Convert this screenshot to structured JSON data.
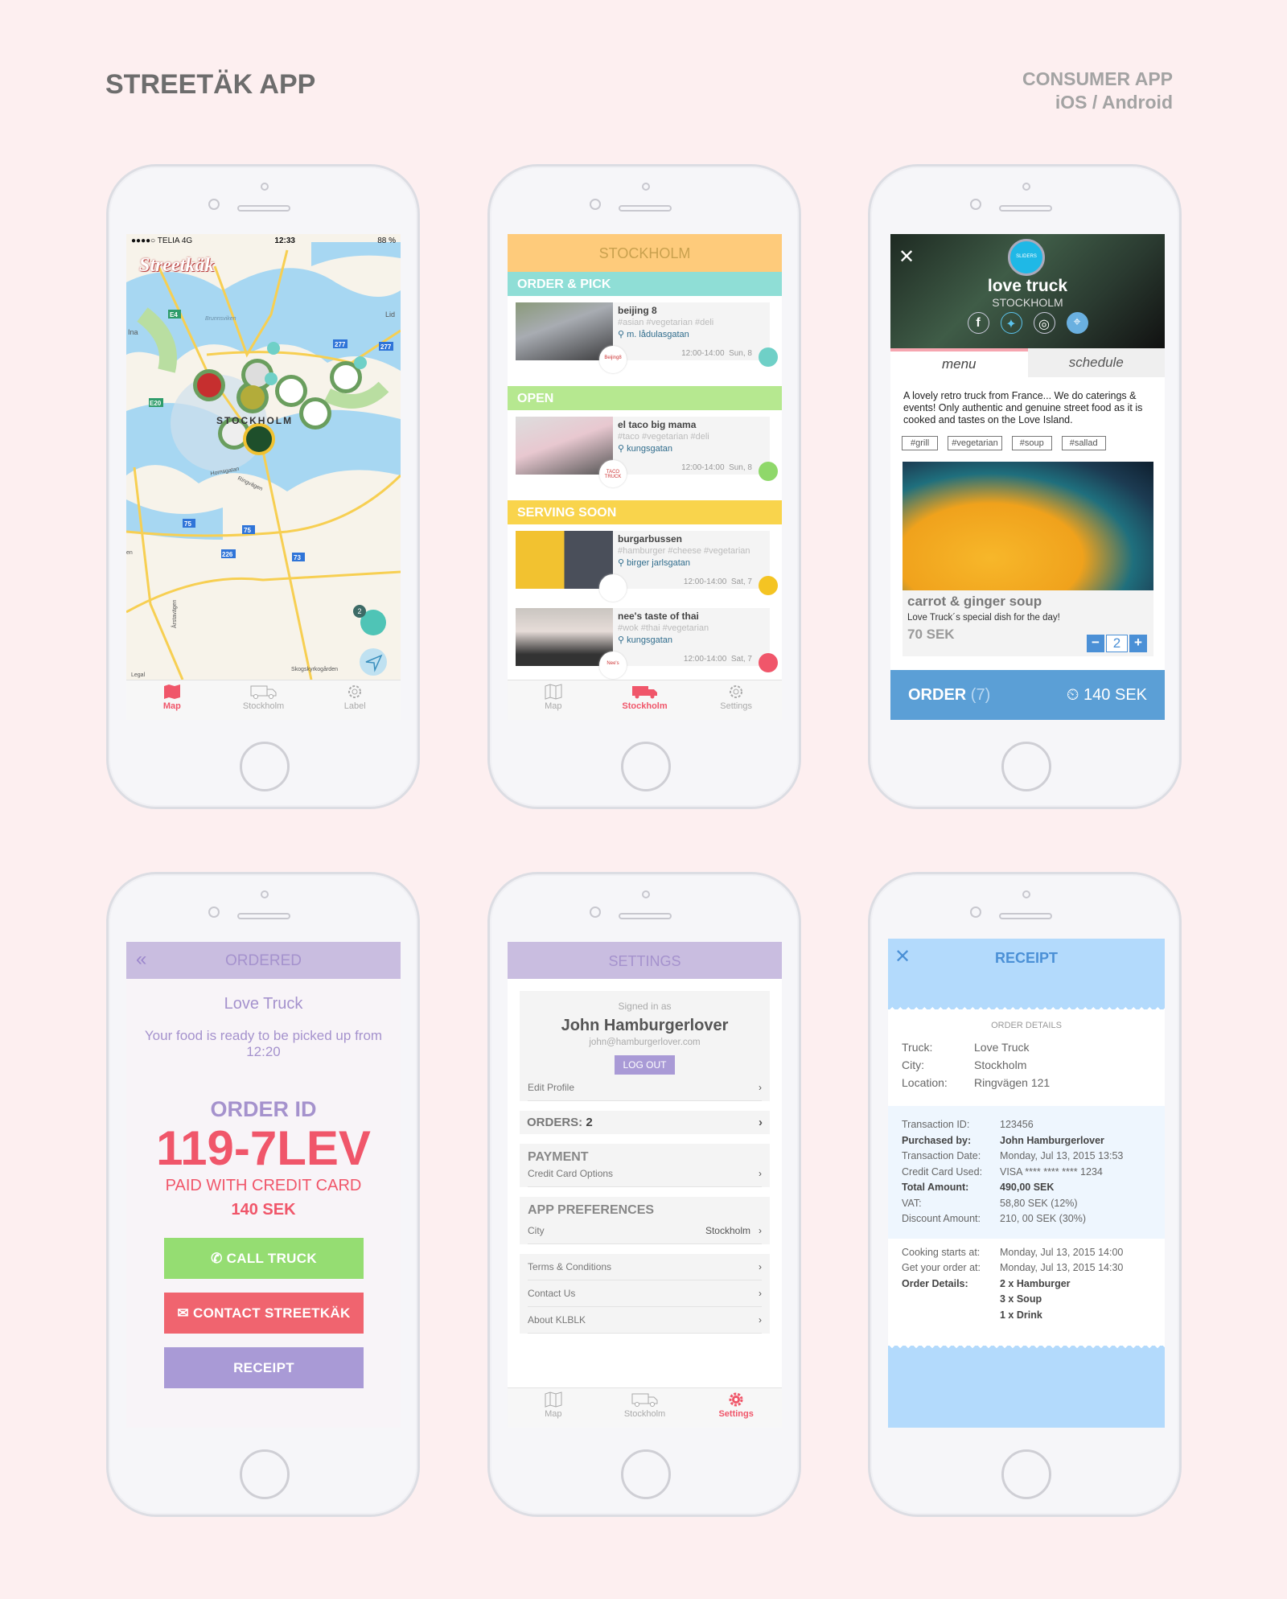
{
  "page": {
    "title": "STREETÄK APP",
    "subtitle_line1": "CONSUMER APP",
    "subtitle_line2": "iOS / Android"
  },
  "colors": {
    "background": "#fdeff0",
    "accent_red": "#f0566a",
    "teal": "#8fded6",
    "green": "#b6e890",
    "yellow": "#f9d44c",
    "orange": "#fecb7b",
    "lavender": "#c9bde0",
    "blue": "#5b9fd6",
    "receipt_blue": "#b3dafc"
  },
  "map_screen": {
    "status": {
      "carrier": "●●●●○ TELIA  4G",
      "time": "12:33",
      "battery": "88 %"
    },
    "logo": "Streetkäk",
    "labels": [
      "Lid",
      "Ina",
      "Brunnsviken",
      "STOCKHOLM",
      "Hornsgatan",
      "Ringvägen",
      "Skogskyrkogården",
      "Legal",
      "Årstavägen",
      "en"
    ],
    "road_badges": [
      "E4",
      "E20",
      "277",
      "277",
      "75",
      "75",
      "226",
      "73"
    ],
    "cart_count": "2",
    "tabs": [
      {
        "label": "Map",
        "icon": "map-icon",
        "active": true
      },
      {
        "label": "Stockholm",
        "icon": "truck-icon"
      },
      {
        "label": "Label",
        "icon": "gear-icon"
      }
    ]
  },
  "list_screen": {
    "header": "STOCKHOLM",
    "sections": [
      {
        "title": "ORDER & PICK",
        "color": "#8fded6",
        "items": [
          {
            "name": "beijing 8",
            "tags": "#asian #vegetarian #deli",
            "location": "m. lådulasgatan",
            "hours": "12:00-14:00",
            "day": "Sun, 8",
            "logo": "Beijing8",
            "status": "order-icon",
            "status_color": "#6fd0c7"
          }
        ]
      },
      {
        "title": "OPEN",
        "color": "#b6e890",
        "items": [
          {
            "name": "el taco big mama",
            "tags": "#taco #vegetarian #deli",
            "location": "kungsgatan",
            "hours": "12:00-14:00",
            "day": "Sun, 8",
            "logo": "TACO TRUCK",
            "status_color": "#8fd86a"
          }
        ]
      },
      {
        "title": "SERVING SOON",
        "color": "#f9d44c",
        "items": [
          {
            "name": "burgarbussen",
            "tags": "#hamburger #cheese #vegetarian",
            "location": "birger jarlsgatan",
            "hours": "12:00-14:00",
            "day": "Sat, 7",
            "logo": "",
            "status_color": "#f4c423"
          },
          {
            "name": "nee's taste of thai",
            "tags": "#wok #thai #vegetarian",
            "location": "kungsgatan",
            "hours": "12:00-14:00",
            "day": "Sat, 7",
            "logo": "Nee's",
            "status_color": "#f0566a"
          }
        ]
      }
    ],
    "tabs": [
      {
        "label": "Map"
      },
      {
        "label": "Stockholm",
        "active": true
      },
      {
        "label": "Settings"
      }
    ]
  },
  "truck_screen": {
    "name": "love truck",
    "city": "STOCKHOLM",
    "badge": "SLIDERS",
    "social": [
      "facebook-icon",
      "twitter-icon",
      "instagram-icon",
      "map-pin-icon"
    ],
    "tabs": [
      {
        "label": "menu",
        "active": true
      },
      {
        "label": "schedule"
      }
    ],
    "description": "A lovely retro truck from France... We do caterings & events! Only authentic and genuine street food as it is cooked and tastes on the Love Island.",
    "tags": [
      "#grill",
      "#vegetarian",
      "#soup",
      "#sallad"
    ],
    "dish": {
      "name": "carrot & ginger soup",
      "desc": "Love Truck´s special dish for the day!",
      "price": "70 SEK",
      "qty": "2",
      "minus": "−",
      "plus": "+"
    },
    "order": {
      "label": "ORDER",
      "count": "(7)",
      "total": "140 SEK"
    }
  },
  "ordered_screen": {
    "header": "ORDERED",
    "truck": "Love Truck",
    "message": "Your food is ready to be picked up from 12:20",
    "order_id_label": "ORDER ID",
    "order_id": "119-7LEV",
    "paid": "PAID WITH CREDIT CARD",
    "amount": "140 SEK",
    "buttons": {
      "call": "CALL TRUCK",
      "contact": "CONTACT STREETKÄK",
      "receipt": "RECEIPT"
    }
  },
  "settings_screen": {
    "header": "SETTINGS",
    "signed_in": "Signed in as",
    "name": "John Hamburgerlover",
    "email": "john@hamburgerlover.com",
    "logout": "LOG OUT",
    "edit_profile": "Edit Profile",
    "orders_label": "ORDERS:",
    "orders_count": "2",
    "payment": "PAYMENT",
    "credit_card": "Credit Card Options",
    "prefs": "APP PREFERENCES",
    "city_label": "City",
    "city_value": "Stockholm",
    "links": [
      "Terms & Conditions",
      "Contact Us",
      "About KLBLK"
    ],
    "tabs": [
      {
        "label": "Map"
      },
      {
        "label": "Stockholm"
      },
      {
        "label": "Settings",
        "active": true
      }
    ]
  },
  "receipt_screen": {
    "header": "RECEIPT",
    "section": "ORDER DETAILS",
    "summary": [
      {
        "k": "Truck:",
        "v": "Love Truck"
      },
      {
        "k": "City:",
        "v": "Stockholm"
      },
      {
        "k": "Location:",
        "v": "Ringvägen 121"
      }
    ],
    "transaction": [
      {
        "k": "Transaction ID:",
        "v": "123456"
      },
      {
        "k": "Purchased by:",
        "v": "John Hamburgerlover",
        "bold": true
      },
      {
        "k": "Transaction Date:",
        "v": "Monday, Jul 13, 2015 13:53"
      },
      {
        "k": "Credit Card Used:",
        "v": "VISA **** **** **** 1234"
      },
      {
        "k": "Total Amount:",
        "v": "490,00 SEK",
        "bold": true
      },
      {
        "k": "VAT:",
        "v": "58,80 SEK (12%)"
      },
      {
        "k": "Discount Amount:",
        "v": "210, 00 SEK (30%)"
      }
    ],
    "timing": [
      {
        "k": "Cooking starts at:",
        "v": "Monday, Jul 13, 2015 14:00"
      },
      {
        "k": "Get your order at:",
        "v": "Monday, Jul 13, 2015 14:30"
      },
      {
        "k": "Order Details:",
        "v": "2 x Hamburger",
        "bold": true
      },
      {
        "k": "",
        "v": "3 x Soup",
        "bold": true
      },
      {
        "k": "",
        "v": "1 x Drink",
        "bold": true
      }
    ]
  }
}
